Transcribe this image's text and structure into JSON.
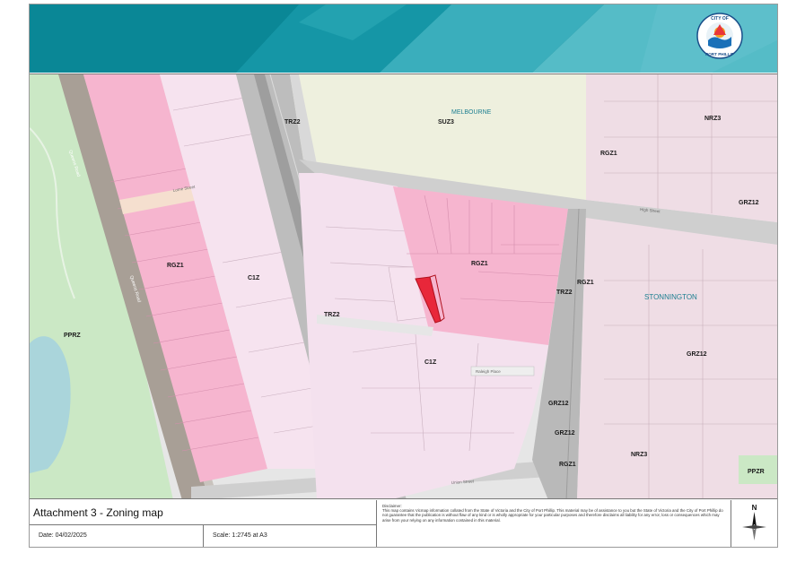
{
  "header": {
    "logo_top_text": "CITY OF",
    "logo_bottom_text": "PORT PHILLIP",
    "colors": {
      "dark": "#0b7d8c",
      "mid": "#1596a6",
      "light": "#43b5c2"
    }
  },
  "map": {
    "labels": {
      "melbourne": "MELBOURNE",
      "suz3": "SUZ3",
      "trz2_top": "TRZ2",
      "nrz3_top": "NRZ3",
      "rgz1_ne": "RGZ1",
      "grz12_ne": "GRZ12",
      "rgz1_west": "RGZ1",
      "c1z_west": "C1Z",
      "trz2_mid": "TRZ2",
      "rgz1_center": "RGZ1",
      "trz2_east": "TRZ2",
      "rgz1_east": "RGZ1",
      "stonnington": "STONNINGTON",
      "c1z_center": "C1Z",
      "grz12_east": "GRZ12",
      "grz12_se1": "GRZ12",
      "grz12_se2": "GRZ12",
      "rgz1_se": "RGZ1",
      "nrz3_se": "NRZ3",
      "ppzr_se": "PPZR",
      "ppzr_west": "PPRZ"
    },
    "streets": {
      "queens_road_top": "Queens Road",
      "queens_road_bottom": "Queens Road",
      "lorne_street": "Lorne Street",
      "union_street": "Union Street",
      "raleigh_place": "Raleigh Place",
      "high_street": "High Street"
    },
    "colors": {
      "rgz": "#f6b5cf",
      "rgz_dark": "#f19fc0",
      "c1z": "#f6e3ef",
      "grz": "#efdde5",
      "suz": "#eef0de",
      "ppzr": "#cbe8c5",
      "road": "#c7c7c7",
      "water": "#aad5db",
      "subject": "#e8273a"
    }
  },
  "footer": {
    "title": "Attachment 3 - Zoning map",
    "date": "Date: 04/02/2025",
    "scale": "Scale: 1:2745 at A3",
    "disclaimer_heading": "Disclaimer:",
    "disclaimer_text": "This map contains Vicmap information collated from the State of Victoria and the City of Port Phillip. This material may be of assistance to you but the State of Victoria and the City of Port Phillip do not guarantee that the publication is without flaw of any kind or is wholly appropriate for your particular purposes and therefore disclaims all liability for any error, loss or consequences which may arise from your relying on any information contained in this material.",
    "north_label": "N"
  }
}
